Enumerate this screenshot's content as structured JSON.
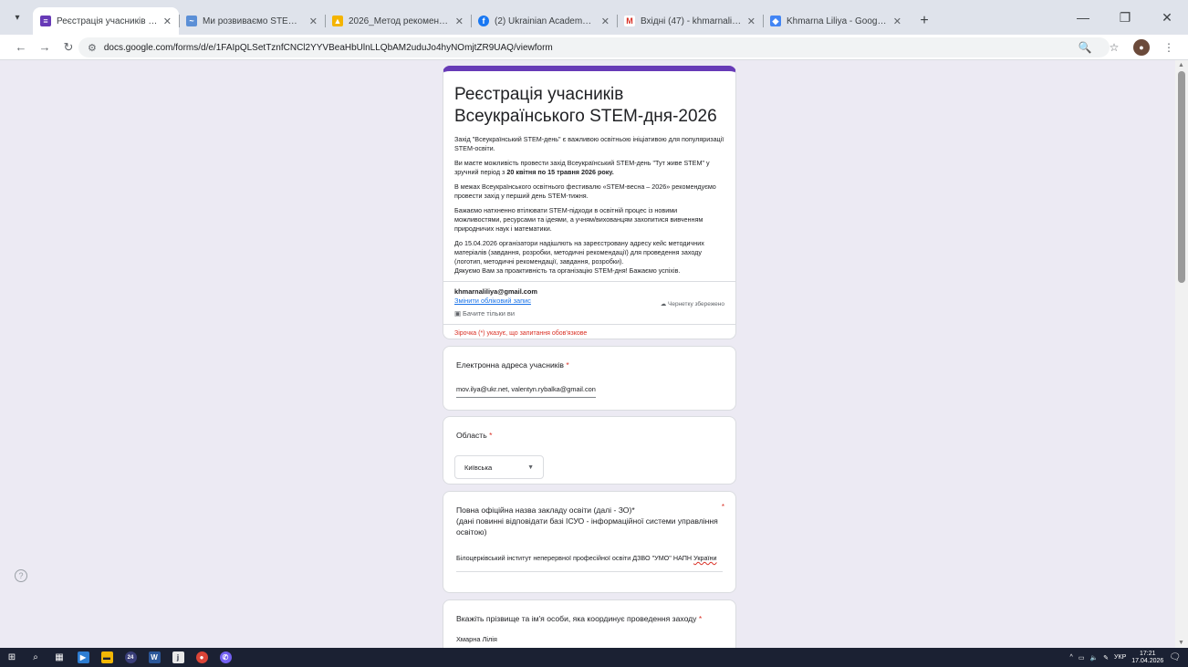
{
  "browser": {
    "tabs": [
      {
        "title": "Реєстрація учасників Всеукраї",
        "fav_color": "#673ab7",
        "fav_glyph": "≡",
        "active": true
      },
      {
        "title": "Ми розвиваємо STEM – Інститу",
        "fav_color": "#5b8fd6",
        "fav_glyph": "~",
        "active": false
      },
      {
        "title": "2026_Метод рекомендації_STE",
        "fav_color": "#f4b400",
        "fav_glyph": "▲",
        "active": false
      },
      {
        "title": "(2) Ukrainian Academy STEM | F",
        "fav_color": "#1877f2",
        "fav_glyph": "f",
        "active": false
      },
      {
        "title": "Вхідні (47) - khmarnaliliya@gm",
        "fav_color": "#d93025",
        "fav_glyph": "M",
        "active": false
      },
      {
        "title": "Khmarna Liliya - Google Акаде",
        "fav_color": "#4285f4",
        "fav_glyph": "◆",
        "active": false
      }
    ],
    "url": "docs.google.com/forms/d/e/1FAIpQLSetTznfCNCl2YYVBeaHbUlnLLQbAM2uduJo4hyNOmjtZR9UAQ/viewform"
  },
  "form": {
    "title": "Реєстрація учасників Всеукраїнського STEM-дня-2026",
    "description": {
      "p1": "Захід \"Всеукраїнський STEM-день\" є важливою освітньою ініціативою для популяризації STEM-освіти.",
      "p2_before": "Ви маєте можливість провести захід Всеукраїнський STEM-день \"Тут живе STEM\" у зручний період з ",
      "p2_bold": "20 квітня по 15 травня 2026 року.",
      "p3": "В межах Всеукраїнського  освітнього фестивалю «STEM-весна – 2026» рекомендуємо провести захід  у перший день STEM-тижня.",
      "p4": "Бажаємо натхненно втілювати STEM-підходи в освітній процес із новими можливостями, ресурсами та ідеями, а учням/вихованцям захопитися вивченням природничих наук і математики.",
      "p5": "До 15.04.2026 організатори надішлють на зареєстровану адресу кейс методичних матеріалів (завдання, розробки, методичні рекомендації) для проведення заходу (логотип, методичні рекомендації, завдання, розробки).",
      "p6": "Дякуємо Вам за проактивність та організацію STEM-дня! Бажаємо успіхів."
    },
    "account": {
      "email": "khmarnaliliya@gmail.com",
      "switch_label": "Змінити обліковий запис",
      "draft_label": "Чернетку збережено",
      "only_you_label": "Бачите тільки ви"
    },
    "required_note": "Зірочка (*) указує, що запитання обов'язкове",
    "questions": [
      {
        "title": "Електронна адреса учасників",
        "answer": "mov.ilya@ukr.net, valentyn.rybalka@gmail.con"
      },
      {
        "title": "Область",
        "answer": "Київська"
      },
      {
        "title_l1": "Повна офіційна назва закладу освіти (далі - ЗО)*",
        "title_l2": "(дані повинні відповідати базі ІСУО - інформаційної системи управління освітою)",
        "answer_main": "Білоцерківський інститут неперервної професійної освіти ДЗВО \"УМО\" НАПН ",
        "answer_spell": "України"
      },
      {
        "title": "Вкажіть прізвище та ім'я особи, яка координує проведення заходу",
        "answer": "Хмарна Лілія"
      }
    ]
  },
  "taskbar": {
    "badge": "24",
    "lang": "УКР",
    "time": "17:21",
    "date": "17.04.2026"
  },
  "colors": {
    "accent": "#673ab7",
    "link": "#1a73e8",
    "required": "#d93025",
    "background": "#eceaf3"
  }
}
